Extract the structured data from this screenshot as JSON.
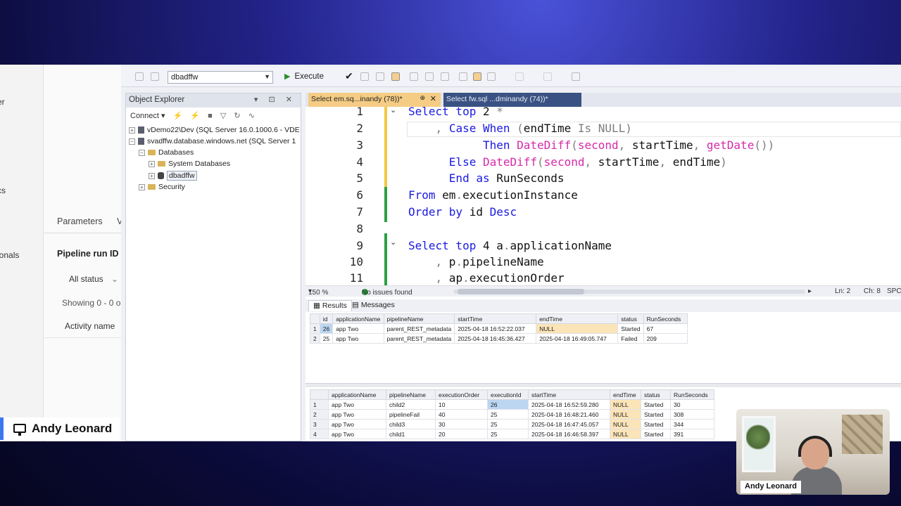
{
  "web_panel": {
    "side_texts": [
      "er",
      "cs",
      "ionals"
    ],
    "tabs": [
      "Parameters",
      "V"
    ],
    "pipeline_run_id_label": "Pipeline run ID",
    "status_filter": "All status",
    "showing_text": "Showing 0 - 0 o",
    "activity_name_header": "Activity name"
  },
  "ssms": {
    "toolbar": {
      "database_selector": "dbadffw",
      "execute_label": "Execute"
    },
    "object_explorer": {
      "title": "Object Explorer",
      "title_controls": "▾ ⊡ ✕",
      "connect_label": "Connect",
      "tree": [
        {
          "label": "vDemo22\\Dev (SQL Server 16.0.1000.6 - VDE",
          "expander": "+",
          "icon": "server"
        },
        {
          "label": "svadffw.database.windows.net (SQL Server 1",
          "expander": "−",
          "icon": "server"
        },
        {
          "label": "Databases",
          "expander": "−",
          "icon": "folder"
        },
        {
          "label": "System Databases",
          "expander": "+",
          "icon": "folder"
        },
        {
          "label": "dbadffw",
          "expander": "+",
          "icon": "database"
        },
        {
          "label": "Security",
          "expander": "+",
          "icon": "folder"
        }
      ]
    },
    "editor": {
      "active_tab": "Select em.sq...inandy (78))*",
      "other_tab": "Select fw.sql ...dminandy (74))*",
      "line_numbers": [
        "1",
        "2",
        "3",
        "4",
        "5",
        "6",
        "7",
        "8",
        "9",
        "10",
        "11"
      ],
      "zoom": "150 %",
      "issues": "No issues found",
      "ln": "Ln: 2",
      "ch": "Ch: 8",
      "mode": "SPC"
    },
    "results": {
      "tab_results": "Results",
      "tab_messages": "Messages",
      "grid1": {
        "columns": [
          "id",
          "applicationName",
          "pipelineName",
          "startTime",
          "endTime",
          "status",
          "RunSeconds"
        ],
        "rows": [
          [
            "1",
            "26",
            "app Two",
            "parent_REST_metadata",
            "2025-04-18 16:52:22.037",
            "NULL",
            "Started",
            "67"
          ],
          [
            "2",
            "25",
            "app Two",
            "parent_REST_metadata",
            "2025-04-18 16:45:36.427",
            "2025-04-18 16:49:05.747",
            "Failed",
            "209"
          ]
        ]
      },
      "grid2": {
        "columns": [
          "applicationName",
          "pipelineName",
          "executionOrder",
          "executionId",
          "startTime",
          "endTime",
          "status",
          "RunSeconds"
        ],
        "rows": [
          [
            "1",
            "app Two",
            "child2",
            "10",
            "26",
            "2025-04-18 16:52:59.280",
            "NULL",
            "Started",
            "30"
          ],
          [
            "2",
            "app Two",
            "pipelineFail",
            "40",
            "25",
            "2025-04-18 16:48:21.460",
            "NULL",
            "Started",
            "308"
          ],
          [
            "3",
            "app Two",
            "child3",
            "30",
            "25",
            "2025-04-18 16:47:45.057",
            "NULL",
            "Started",
            "344"
          ],
          [
            "4",
            "app Two",
            "child1",
            "20",
            "25",
            "2025-04-18 16:46:58.397",
            "NULL",
            "Started",
            "391"
          ]
        ]
      }
    }
  },
  "presenter": {
    "name": "Andy Leonard"
  },
  "webcam": {
    "name": "Andy Leonard"
  },
  "colors": {
    "active_tab": "#f5cc84",
    "keyword": "#1a1ae0",
    "function": "#d42aa8",
    "null_highlight": "#fbe4b8"
  }
}
